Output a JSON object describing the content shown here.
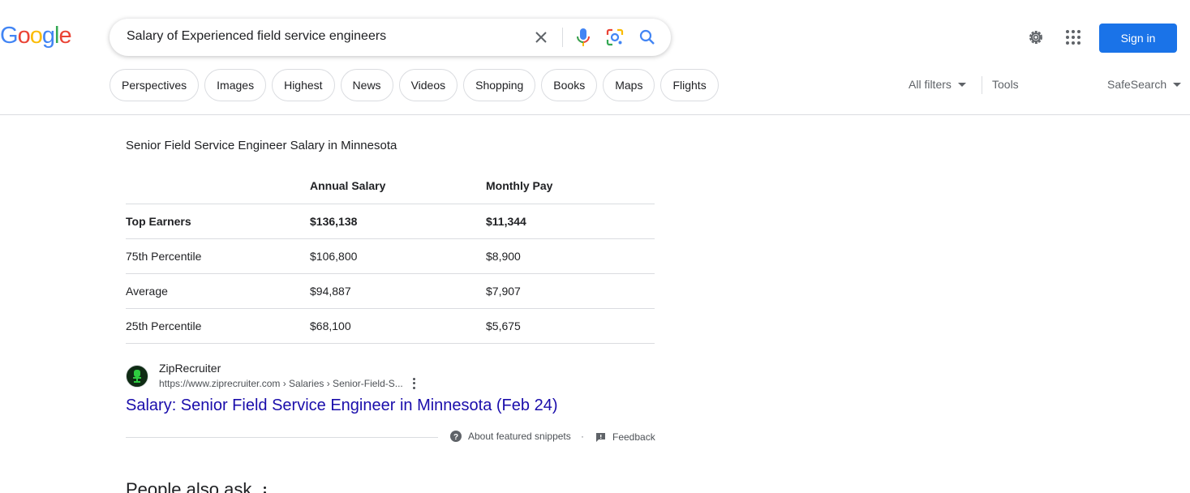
{
  "logo": {
    "letters": [
      "G",
      "o",
      "o",
      "g",
      "l",
      "e"
    ],
    "colors": [
      "#4285f4",
      "#ea4335",
      "#fbbc05",
      "#4285f4",
      "#34a853",
      "#ea4335"
    ]
  },
  "search": {
    "query": "Salary of Experienced field service engineers"
  },
  "header": {
    "sign_in": "Sign in",
    "accent": "#1a73e8"
  },
  "chips": [
    "Perspectives",
    "Images",
    "Highest",
    "News",
    "Videos",
    "Shopping",
    "Books",
    "Maps",
    "Flights"
  ],
  "filters": {
    "all_filters": "All filters",
    "tools": "Tools",
    "safesearch": "SafeSearch"
  },
  "snippet": {
    "title": "Senior Field Service Engineer Salary in Minnesota",
    "columns": [
      "",
      "Annual Salary",
      "Monthly Pay"
    ],
    "rows": [
      [
        "Top Earners",
        "$136,138",
        "$11,344"
      ],
      [
        "75th Percentile",
        "$106,800",
        "$8,900"
      ],
      [
        "Average",
        "$94,887",
        "$7,907"
      ],
      [
        "25th Percentile",
        "$68,100",
        "$5,675"
      ]
    ],
    "source_name": "ZipRecruiter",
    "source_url": "https://www.ziprecruiter.com › Salaries › Senior-Field-S...",
    "link_text": "Salary: Senior Field Service Engineer in Minnesota (Feb 24)",
    "about": "About featured snippets",
    "separator": "·",
    "feedback": "Feedback"
  },
  "paa": {
    "heading": "People also ask"
  }
}
